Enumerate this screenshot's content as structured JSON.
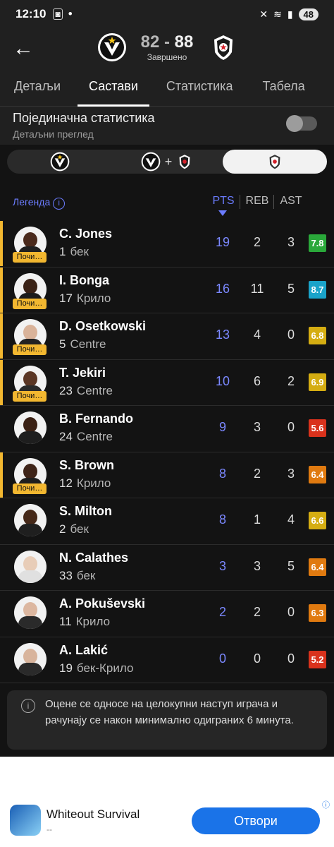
{
  "status_bar": {
    "time": "12:10",
    "battery": "48"
  },
  "header": {
    "score_home": "82",
    "score_sep": " - ",
    "score_away": "88",
    "status": "Завршено"
  },
  "tabs": [
    {
      "label": "Детаљи"
    },
    {
      "label": "Састави"
    },
    {
      "label": "Статистика"
    },
    {
      "label": "Табела"
    }
  ],
  "individual": {
    "title": "Појединачна статистика",
    "subtitle": "Детаљни преглед"
  },
  "table": {
    "legend_label": "Легенда",
    "col_pts": "PTS",
    "col_reb": "REB",
    "col_ast": "AST",
    "starter_badge": "Почи…"
  },
  "players": [
    {
      "name": "C. Jones",
      "number": "1",
      "position": "бек",
      "pts": "19",
      "reb": "2",
      "ast": "3",
      "rating": "7.8",
      "rating_color": "#2aa83a",
      "starter": true,
      "skin": "#4a2a1c",
      "shirt": "#202020"
    },
    {
      "name": "I. Bonga",
      "number": "17",
      "position": "Крило",
      "pts": "16",
      "reb": "11",
      "ast": "5",
      "rating": "8.7",
      "rating_color": "#1aa3c9",
      "starter": true,
      "skin": "#3a2216",
      "shirt": "#1c1c1c"
    },
    {
      "name": "D. Osetkowski",
      "number": "5",
      "position": "Centre",
      "pts": "13",
      "reb": "4",
      "ast": "0",
      "rating": "6.8",
      "rating_color": "#d5ad12",
      "starter": true,
      "skin": "#d9b39a",
      "shirt": "#222222"
    },
    {
      "name": "T. Jekiri",
      "number": "23",
      "position": "Centre",
      "pts": "10",
      "reb": "6",
      "ast": "2",
      "rating": "6.9",
      "rating_color": "#d5ad12",
      "starter": true,
      "skin": "#5a3624",
      "shirt": "#2a2a2a"
    },
    {
      "name": "B. Fernando",
      "number": "24",
      "position": "Centre",
      "pts": "9",
      "reb": "3",
      "ast": "0",
      "rating": "5.6",
      "rating_color": "#d9321c",
      "starter": false,
      "skin": "#3b2114",
      "shirt": "#1e1e1e"
    },
    {
      "name": "S. Brown",
      "number": "12",
      "position": "Крило",
      "pts": "8",
      "reb": "2",
      "ast": "3",
      "rating": "6.4",
      "rating_color": "#e07a10",
      "starter": true,
      "skin": "#3e2418",
      "shirt": "#1e1e1e"
    },
    {
      "name": "S. Milton",
      "number": "2",
      "position": "бек",
      "pts": "8",
      "reb": "1",
      "ast": "4",
      "rating": "6.6",
      "rating_color": "#d5ad12",
      "starter": false,
      "skin": "#452818",
      "shirt": "#1f1f1f"
    },
    {
      "name": "N. Calathes",
      "number": "33",
      "position": "бек",
      "pts": "3",
      "reb": "3",
      "ast": "5",
      "rating": "6.4",
      "rating_color": "#e07a10",
      "starter": false,
      "skin": "#e8cdb8",
      "shirt": "#e0e0e0"
    },
    {
      "name": "A. Pokuševski",
      "number": "11",
      "position": "Крило",
      "pts": "2",
      "reb": "2",
      "ast": "0",
      "rating": "6.3",
      "rating_color": "#e07a10",
      "starter": false,
      "skin": "#dcb7a0",
      "shirt": "#2a2a2a"
    },
    {
      "name": "A. Lakić",
      "number": "19",
      "position": "бек-Крило",
      "pts": "0",
      "reb": "0",
      "ast": "0",
      "rating": "5.2",
      "rating_color": "#d9321c",
      "starter": false,
      "skin": "#d8b49c",
      "shirt": "#2a2a2a"
    }
  ],
  "note": "Оцене се односе на целокупни наступ играча и рачунају се након минимално одиграних 6 минута.",
  "ad": {
    "app_name": "Whiteout Survival",
    "sub": "--",
    "button": "Отвори"
  }
}
